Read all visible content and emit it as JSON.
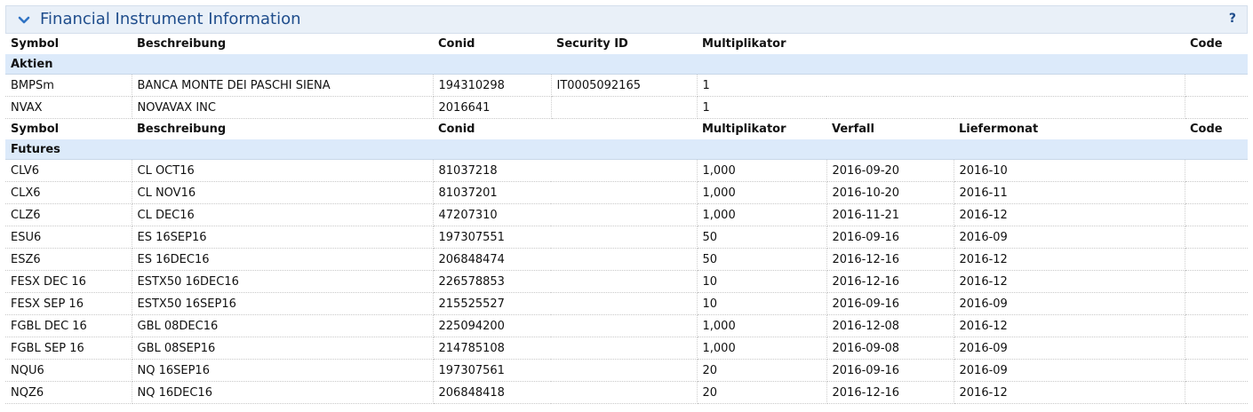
{
  "panel": {
    "title": "Financial Instrument Information",
    "help": "?"
  },
  "stocks": {
    "headers": {
      "symbol": "Symbol",
      "description": "Beschreibung",
      "conid": "Conid",
      "security_id": "Security ID",
      "multiplier": "Multiplikator",
      "code": "Code"
    },
    "section": "Aktien",
    "rows": [
      {
        "symbol": "BMPSm",
        "description": "BANCA MONTE DEI PASCHI SIENA",
        "conid": "194310298",
        "security_id": "IT0005092165",
        "multiplier": "1",
        "code": ""
      },
      {
        "symbol": "NVAX",
        "description": "NOVAVAX INC",
        "conid": "2016641",
        "security_id": "",
        "multiplier": "1",
        "code": ""
      }
    ]
  },
  "futures": {
    "headers": {
      "symbol": "Symbol",
      "description": "Beschreibung",
      "conid": "Conid",
      "multiplier": "Multiplikator",
      "expiry": "Verfall",
      "delivery": "Liefermonat",
      "code": "Code"
    },
    "section": "Futures",
    "rows": [
      {
        "symbol": "CLV6",
        "description": "CL OCT16",
        "conid": "81037218",
        "multiplier": "1,000",
        "expiry": "2016-09-20",
        "delivery": "2016-10",
        "code": ""
      },
      {
        "symbol": "CLX6",
        "description": "CL NOV16",
        "conid": "81037201",
        "multiplier": "1,000",
        "expiry": "2016-10-20",
        "delivery": "2016-11",
        "code": ""
      },
      {
        "symbol": "CLZ6",
        "description": "CL DEC16",
        "conid": "47207310",
        "multiplier": "1,000",
        "expiry": "2016-11-21",
        "delivery": "2016-12",
        "code": ""
      },
      {
        "symbol": "ESU6",
        "description": "ES 16SEP16",
        "conid": "197307551",
        "multiplier": "50",
        "expiry": "2016-09-16",
        "delivery": "2016-09",
        "code": ""
      },
      {
        "symbol": "ESZ6",
        "description": "ES 16DEC16",
        "conid": "206848474",
        "multiplier": "50",
        "expiry": "2016-12-16",
        "delivery": "2016-12",
        "code": ""
      },
      {
        "symbol": "FESX DEC 16",
        "description": "ESTX50 16DEC16",
        "conid": "226578853",
        "multiplier": "10",
        "expiry": "2016-12-16",
        "delivery": "2016-12",
        "code": ""
      },
      {
        "symbol": "FESX SEP 16",
        "description": "ESTX50 16SEP16",
        "conid": "215525527",
        "multiplier": "10",
        "expiry": "2016-09-16",
        "delivery": "2016-09",
        "code": ""
      },
      {
        "symbol": "FGBL DEC 16",
        "description": "GBL 08DEC16",
        "conid": "225094200",
        "multiplier": "1,000",
        "expiry": "2016-12-08",
        "delivery": "2016-12",
        "code": ""
      },
      {
        "symbol": "FGBL SEP 16",
        "description": "GBL 08SEP16",
        "conid": "214785108",
        "multiplier": "1,000",
        "expiry": "2016-09-08",
        "delivery": "2016-09",
        "code": ""
      },
      {
        "symbol": "NQU6",
        "description": "NQ 16SEP16",
        "conid": "197307561",
        "multiplier": "20",
        "expiry": "2016-09-16",
        "delivery": "2016-09",
        "code": ""
      },
      {
        "symbol": "NQZ6",
        "description": "NQ 16DEC16",
        "conid": "206848418",
        "multiplier": "20",
        "expiry": "2016-12-16",
        "delivery": "2016-12",
        "code": ""
      }
    ]
  }
}
